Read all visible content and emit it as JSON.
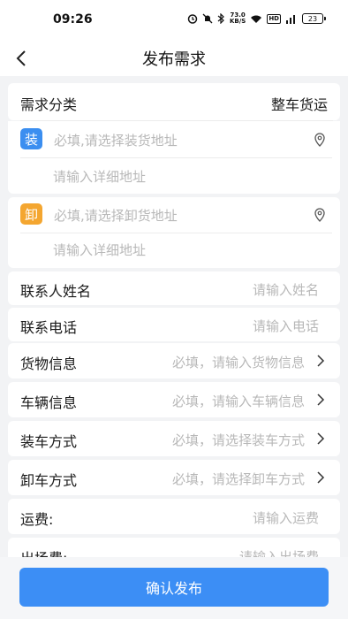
{
  "status": {
    "time": "09:26",
    "speed_value": "73.0",
    "speed_unit": "KB/S",
    "hd": "HD",
    "net": "5G",
    "battery": "23"
  },
  "nav": {
    "title": "发布需求"
  },
  "category": {
    "label": "需求分类",
    "value": "整车货运"
  },
  "load": {
    "tag": "装",
    "address_placeholder": "必填,请选择装货地址",
    "detail_placeholder": "请输入详细地址",
    "tag_color": "#3b8ef0"
  },
  "unload": {
    "tag": "卸",
    "address_placeholder": "必填,请选择卸货地址",
    "detail_placeholder": "请输入详细地址",
    "tag_color": "#f4a630"
  },
  "contact": {
    "label": "联系人姓名",
    "placeholder": "请输入姓名"
  },
  "phone": {
    "label": "联系电话",
    "placeholder": "请输入电话"
  },
  "goods": {
    "label": "货物信息",
    "placeholder": "必填，请输入货物信息"
  },
  "vehicle": {
    "label": "车辆信息",
    "placeholder": "必填，请输入车辆信息"
  },
  "loading_method": {
    "label": "装车方式",
    "placeholder": "必填，请选择装车方式"
  },
  "unloading_method": {
    "label": "卸车方式",
    "placeholder": "必填，请选择卸车方式"
  },
  "freight": {
    "label": "运费:",
    "placeholder": "请输入运费"
  },
  "exit_fee": {
    "label": "出场费:",
    "placeholder": "请输入出场费"
  },
  "submit": {
    "label": "确认发布",
    "color": "#3c8ef5"
  }
}
